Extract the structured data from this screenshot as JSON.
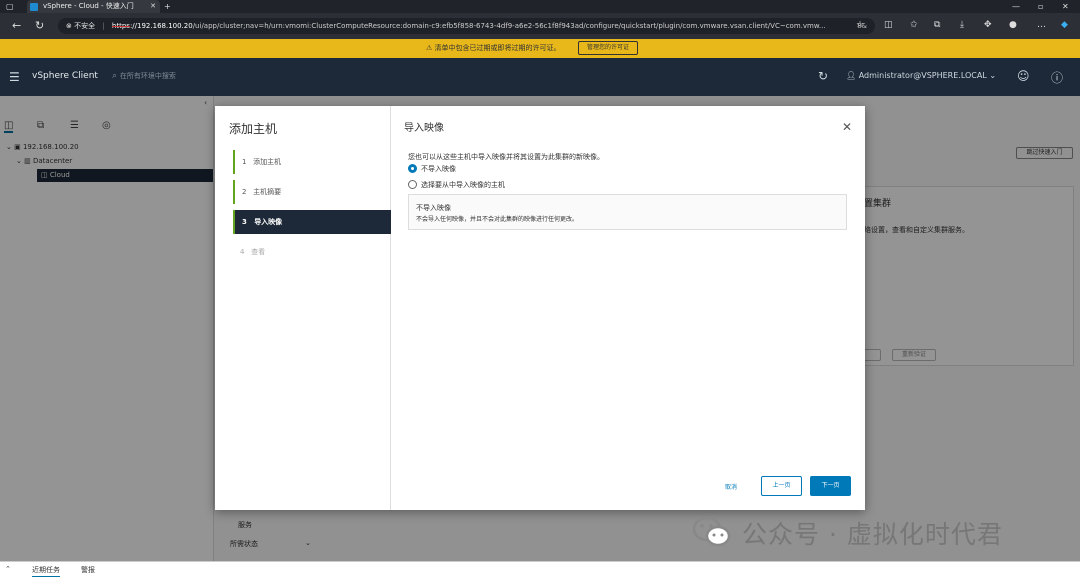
{
  "browser": {
    "tab_title": "vSphere - Cloud - 快速入门",
    "tab_close": "✕",
    "new_tab": "+",
    "security_warning": "不安全",
    "url_protocol": "https",
    "url_host": "://192.168.100.20",
    "url_path": "/ui/app/cluster;nav=h/urn:vmomi:ClusterComputeResource:domain-c9:efb5f858-6743-4df9-a6e2-56c1f8f943ad/configure/quickstart/plugin/com.vmware.vsan.client/VC~com.vmw...",
    "url_end": "8&"
  },
  "banner": {
    "text": "清单中包含已过期或即将过期的许可证。",
    "button": "管理您的许可证"
  },
  "header": {
    "app_name": "vSphere Client",
    "search_placeholder": "在所有环境中搜索",
    "user": "Administrator@VSPHERE.LOCAL"
  },
  "tree": {
    "vcenter": "192.168.100.20",
    "datacenter": "Datacenter",
    "cluster": "Cloud"
  },
  "background": {
    "quickstart_button": "跳过快速入门",
    "card_title": "置集群",
    "card_desc": "络设置，查看和自定义集群服务。",
    "card_btn2": "重新验证",
    "side_item_services": "服务",
    "side_item_status": "所需状态"
  },
  "wizard": {
    "title": "添加主机",
    "steps": [
      {
        "num": "1",
        "label": "添加主机"
      },
      {
        "num": "2",
        "label": "主机摘要"
      },
      {
        "num": "3",
        "label": "导入映像"
      },
      {
        "num": "4",
        "label": "查看"
      }
    ],
    "content_title": "导入映像",
    "intro": "您也可以从这些主机中导入映像并将其设置为此集群的新映像。",
    "option_no_import": "不导入映像",
    "option_select_host": "选择要从中导入映像的主机",
    "info_title": "不导入映像",
    "info_desc": "不会导入任何映像，并且不会对此集群的映像进行任何更改。",
    "cancel": "取消",
    "back": "上一页",
    "next": "下一页"
  },
  "bottom": {
    "recent_tasks": "近期任务",
    "alarms": "警报"
  },
  "watermark": {
    "text": "公众号 · 虚拟化时代君"
  }
}
